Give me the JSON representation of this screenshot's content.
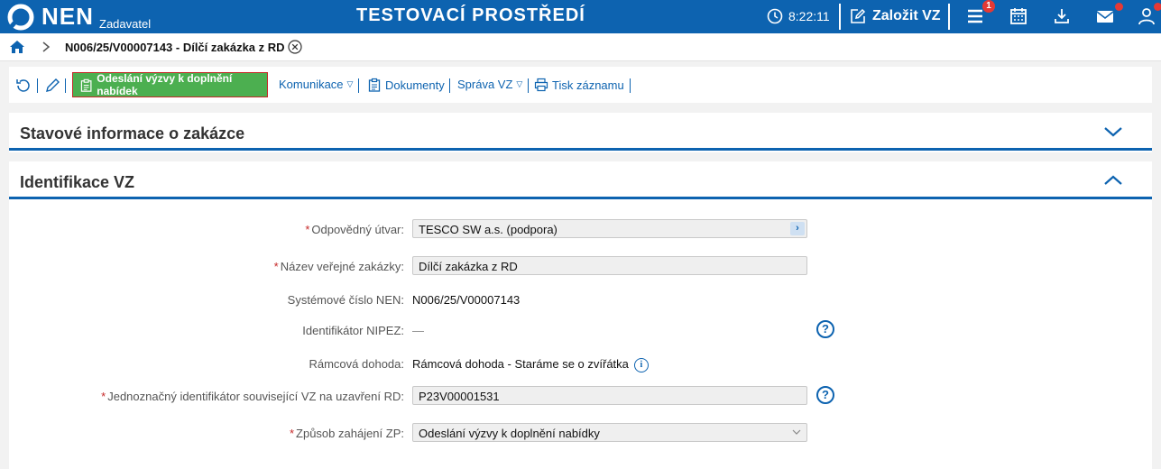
{
  "topbar": {
    "brand": "NEN",
    "brand_sub": "Zadavatel",
    "env_title": "TESTOVACÍ PROSTŘEDÍ",
    "clock": "8:22:11",
    "create_label": "Založit VZ",
    "menu_badge": "1",
    "colors": {
      "bar": "#0d63b0",
      "badge": "#e53935"
    },
    "icons": [
      "clock-icon",
      "edit-icon",
      "menu-icon",
      "calendar-icon",
      "download-icon",
      "mail-icon",
      "user-icon"
    ]
  },
  "breadcrumb": {
    "title": "N006/25/V00007143 - Dílčí zakázka z RD"
  },
  "toolbar": {
    "primary_action": "Odeslání výzvy k doplnění nabídek",
    "links": {
      "komunikace": "Komunikace",
      "dokumenty": "Dokumenty",
      "sprava": "Správa VZ",
      "tisk": "Tisk záznamu"
    },
    "colors": {
      "primary": "#4caf50",
      "link": "#0d63b0"
    }
  },
  "panels": {
    "status": {
      "title": "Stavové informace o zakázce",
      "expanded": false
    },
    "identifikace": {
      "title": "Identifikace VZ",
      "expanded": true
    }
  },
  "form": {
    "utvar": {
      "label": "Odpovědný útvar:",
      "value": "TESCO SW a.s. (podpora)",
      "required": true
    },
    "nazev": {
      "label": "Název veřejné zakázky:",
      "value": "Dílčí zakázka z RD",
      "required": true
    },
    "system_cislo": {
      "label": "Systémové číslo NEN:",
      "value": "N006/25/V00007143"
    },
    "nipez": {
      "label": "Identifikátor NIPEZ:",
      "value": "—"
    },
    "ramcova": {
      "label": "Rámcová dohoda:",
      "value": "Rámcová dohoda - Staráme se o zvířátka"
    },
    "identifikator_rd": {
      "label": "Jednoznačný identifikátor související VZ na uzavření RD:",
      "value": "P23V00001531",
      "required": true
    },
    "zpusob": {
      "label": "Způsob zahájení ZP:",
      "value": "Odeslání výzvy k doplnění nabídky",
      "required": true
    }
  }
}
